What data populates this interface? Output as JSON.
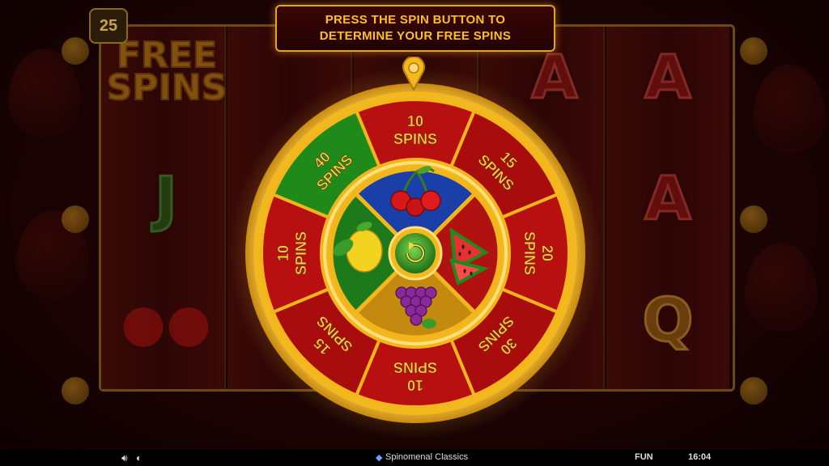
{
  "level_badge": "25",
  "banner": {
    "line1": "PRESS THE SPIN BUTTON TO",
    "line2": "DETERMINE YOUR FREE SPINS"
  },
  "reel_symbols": {
    "free_top": "FREE",
    "free_bottom": "SPINS",
    "reel1_mid": "J",
    "reel5_top": "A",
    "reel5_mid": "A",
    "reel5_bot": "Q",
    "reel4_top": "A"
  },
  "wheel": {
    "segments": [
      {
        "num": "10",
        "word": "SPINS",
        "color": "#b81010"
      },
      {
        "num": "15",
        "word": "SPINS",
        "color": "#a80c0c"
      },
      {
        "num": "20",
        "word": "SPINS",
        "color": "#b81010"
      },
      {
        "num": "30",
        "word": "SPINS",
        "color": "#a80c0c"
      },
      {
        "num": "10",
        "word": "SPINS",
        "color": "#b81010"
      },
      {
        "num": "15",
        "word": "SPINS",
        "color": "#a80c0c"
      },
      {
        "num": "10",
        "word": "SPINS",
        "color": "#b81010"
      },
      {
        "num": "40",
        "word": "SPINS",
        "color": "#1f8a1a"
      }
    ],
    "inner_quadrants": [
      {
        "fruit": "cherries",
        "color": "#1a3fa8"
      },
      {
        "fruit": "watermelon",
        "color": "#b01212"
      },
      {
        "fruit": "grapes",
        "color": "#c48a10"
      },
      {
        "fruit": "lemon",
        "color": "#1d7a1a"
      }
    ],
    "gold": "#f2b61c",
    "accent": "#ffd24a"
  },
  "spin_button": "refresh-icon",
  "bottom_bar": {
    "sound_icon": "speaker-icon",
    "turbo_icon": "rabbit-icon",
    "brand": "Spinomenal Classics",
    "mode": "FUN",
    "time": "16:04"
  }
}
